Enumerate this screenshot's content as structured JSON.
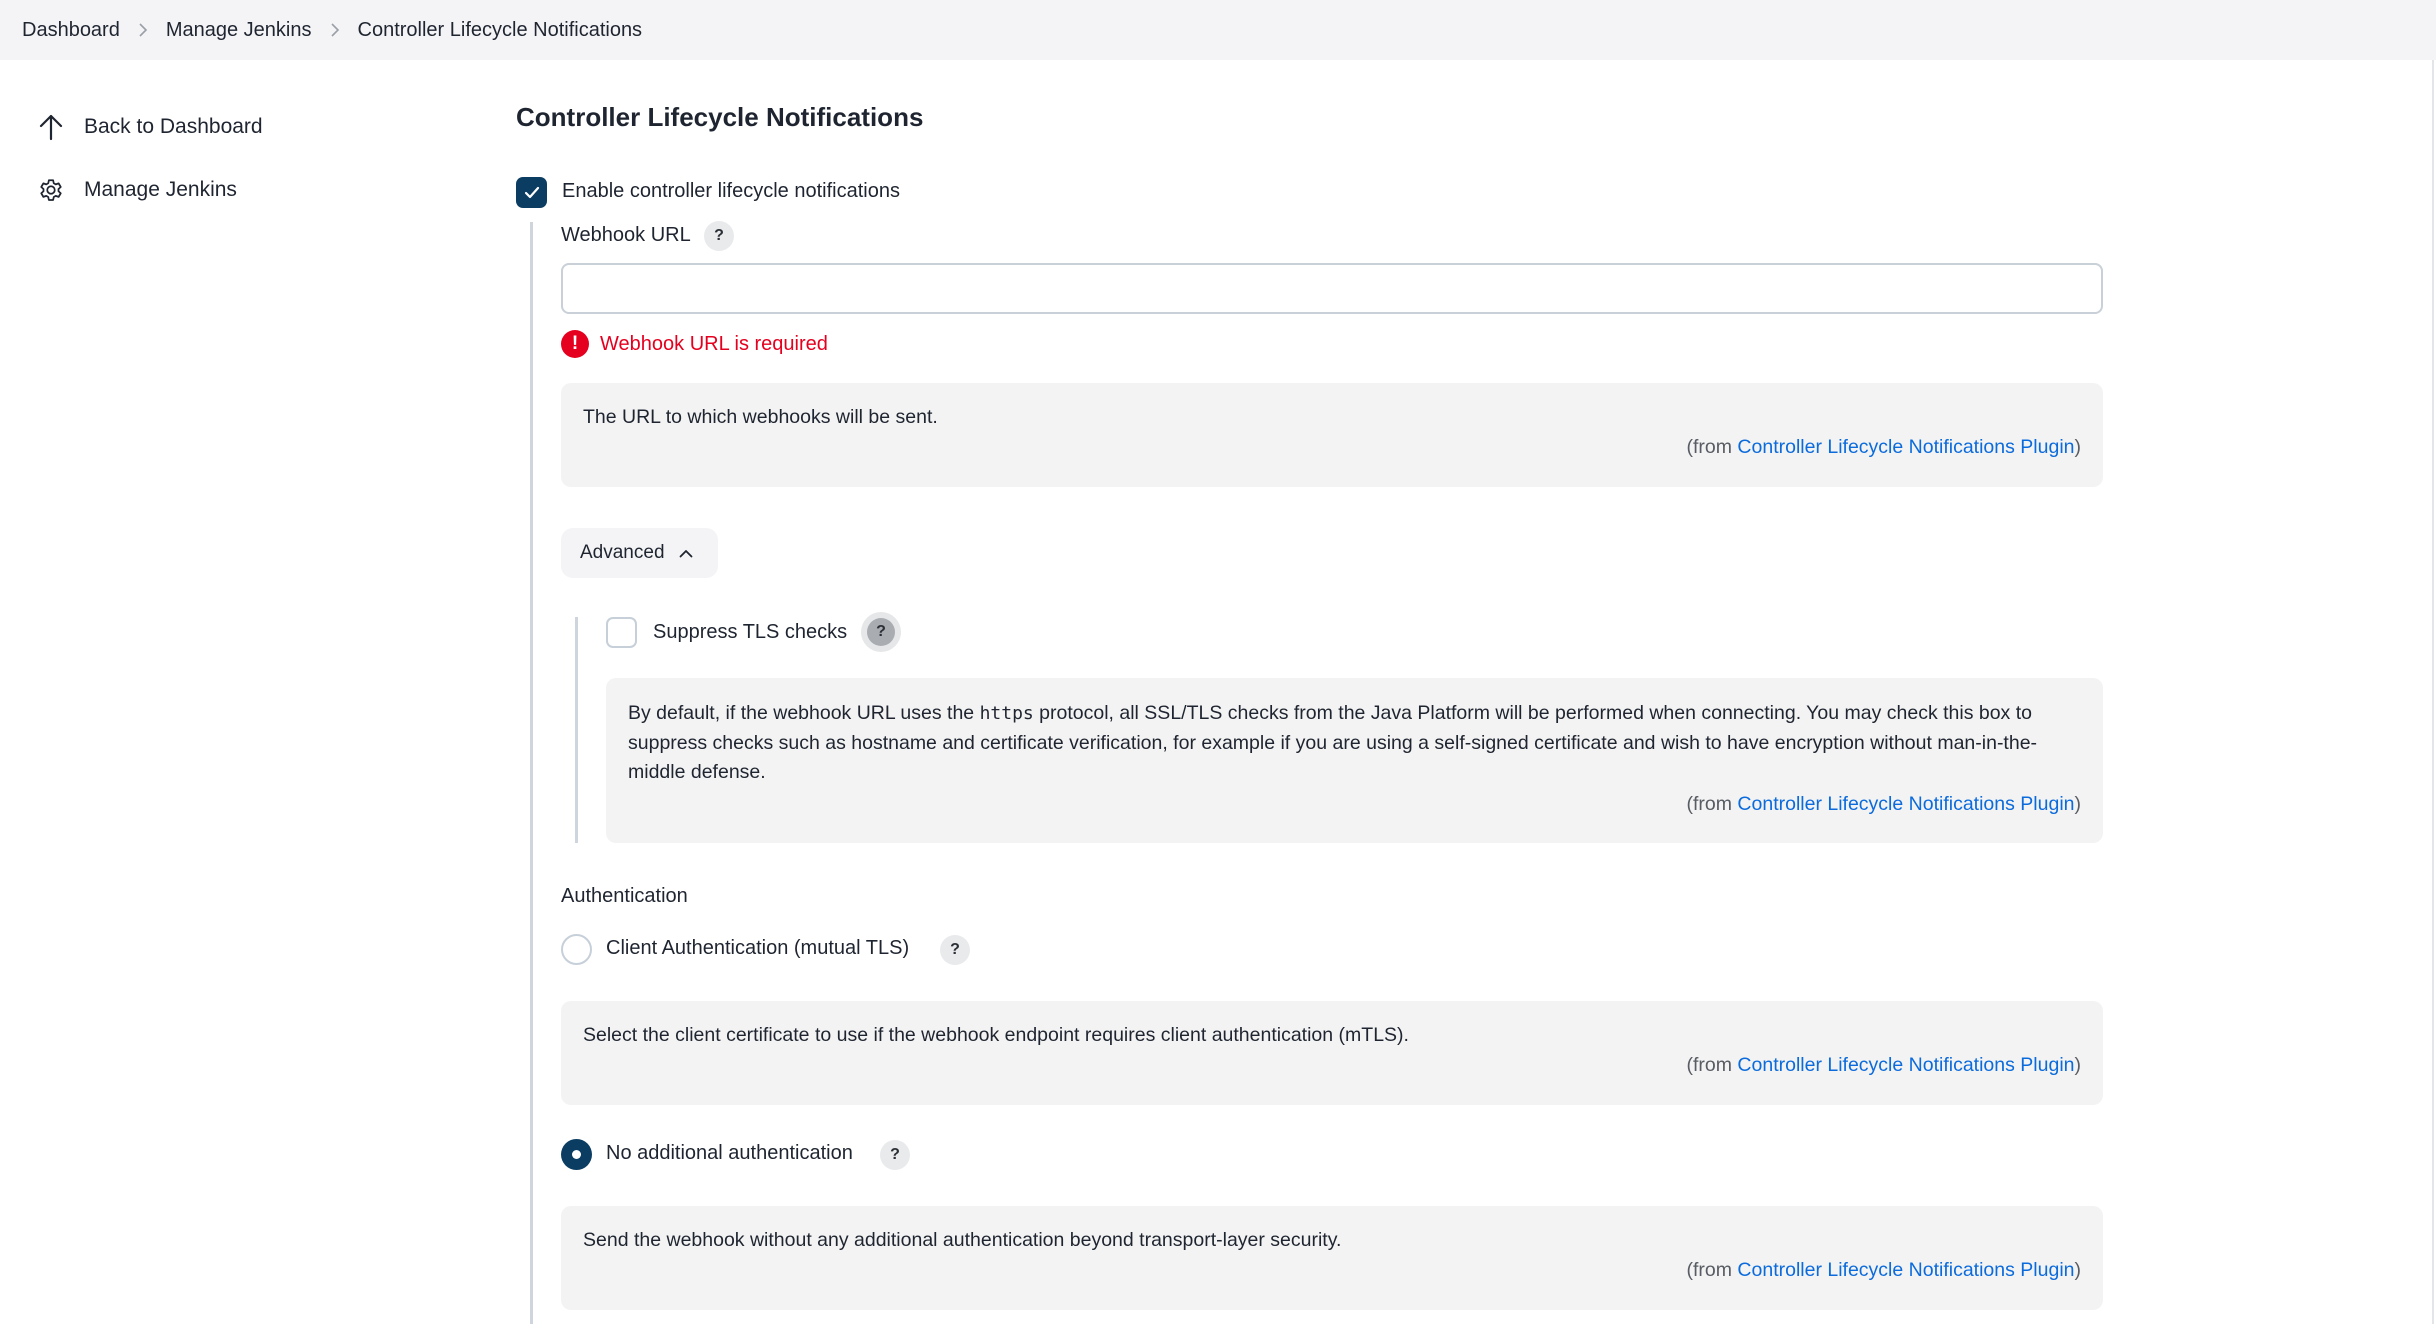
{
  "breadcrumb": {
    "items": [
      "Dashboard",
      "Manage Jenkins",
      "Controller Lifecycle Notifications"
    ]
  },
  "sidebar": {
    "items": [
      {
        "label": "Back to Dashboard",
        "icon": "arrow-up-icon"
      },
      {
        "label": "Manage Jenkins",
        "icon": "gear-icon"
      }
    ]
  },
  "main": {
    "title": "Controller Lifecycle Notifications",
    "enable": {
      "label": "Enable controller lifecycle notifications",
      "checked": true
    },
    "webhook": {
      "label": "Webhook URL",
      "value": "",
      "placeholder": "",
      "error": "Webhook URL is required",
      "help_text": "The URL to which webhooks will be sent.",
      "help_from_prefix": "(from ",
      "help_from_link": "Controller Lifecycle Notifications Plugin",
      "help_from_suffix": ")"
    },
    "advanced": {
      "label": "Advanced",
      "expanded": true
    },
    "suppress_tls": {
      "label": "Suppress TLS checks",
      "checked": false,
      "help_text_before_code": "By default, if the webhook URL uses the ",
      "help_code": "https",
      "help_text_after_code": " protocol, all SSL/TLS checks from the Java Platform will be performed when connecting. You may check this box to suppress checks such as hostname and certificate verification, for example if you are using a self-signed certificate and wish to have encryption without man-in-the-middle defense.",
      "help_from_prefix": "(from ",
      "help_from_link": "Controller Lifecycle Notifications Plugin",
      "help_from_suffix": ")"
    },
    "authentication": {
      "label": "Authentication",
      "options": [
        {
          "label": "Client Authentication (mutual TLS)",
          "selected": false,
          "help_text": "Select the client certificate to use if the webhook endpoint requires client authentication (mTLS).",
          "help_from_prefix": "(from ",
          "help_from_link": "Controller Lifecycle Notifications Plugin",
          "help_from_suffix": ")"
        },
        {
          "label": "No additional authentication",
          "selected": true,
          "help_text": "Send the webhook without any additional authentication beyond transport-layer security.",
          "help_from_prefix": "(from ",
          "help_from_link": "Controller Lifecycle Notifications Plugin",
          "help_from_suffix": ")"
        }
      ]
    },
    "help_icon_text": "?",
    "error_icon_text": "!"
  },
  "colors": {
    "accent": "#0b3d63",
    "error": "#e6001f",
    "link": "#0b6bdc",
    "help_box_bg": "#f3f3f3",
    "breadcrumb_bg": "#f4f4f6"
  }
}
